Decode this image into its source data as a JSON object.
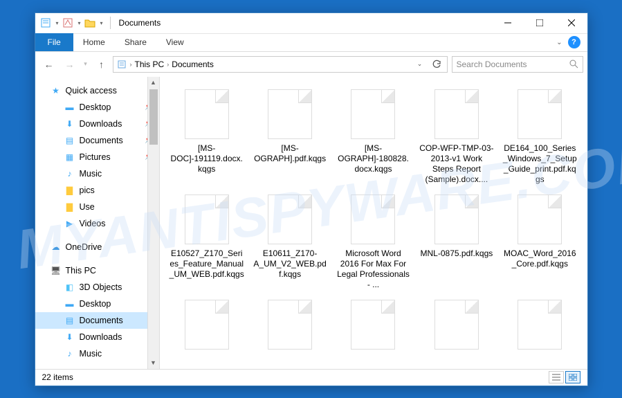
{
  "title": "Documents",
  "ribbon": {
    "file": "File",
    "home": "Home",
    "share": "Share",
    "view": "View"
  },
  "breadcrumb": {
    "root": "This PC",
    "current": "Documents"
  },
  "search": {
    "placeholder": "Search Documents"
  },
  "sidebar": {
    "quick_access": "Quick access",
    "onedrive": "OneDrive",
    "this_pc": "This PC",
    "items": {
      "desktop": "Desktop",
      "downloads": "Downloads",
      "documents": "Documents",
      "pictures": "Pictures",
      "music": "Music",
      "pics": "pics",
      "use": "Use",
      "videos": "Videos",
      "objects3d": "3D Objects"
    }
  },
  "files": [
    "[MS-DOC]-191119.docx.kqgs",
    "[MS-OGRAPH].pdf.kqgs",
    "[MS-OGRAPH]-180828.docx.kqgs",
    "COP-WFP-TMP-03-2013-v1 Work Steps Report (Sample).docx....",
    "DE164_100_Series_Windows_7_Setup_Guide_print.pdf.kqgs",
    "E10527_Z170_Series_Feature_Manual_UM_WEB.pdf.kqgs",
    "E10611_Z170-A_UM_V2_WEB.pdf.kqgs",
    "Microsoft Word 2016 For Max For Legal Professionals - ...",
    "MNL-0875.pdf.kqgs",
    "MOAC_Word_2016_Core.pdf.kqgs",
    "",
    "",
    "",
    "",
    ""
  ],
  "status": {
    "count": "22 items"
  },
  "watermark": "MYANTISPYWARE.COM"
}
